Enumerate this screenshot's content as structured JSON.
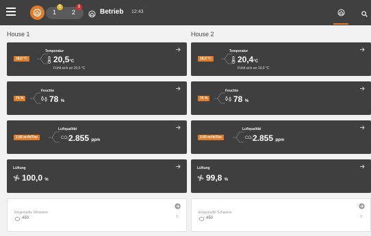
{
  "topbar": {
    "badge_1": "1",
    "badge_2": "2",
    "badge_1_count": "1",
    "badge_2_count": "1",
    "mode": "Betrieb",
    "time": "12:43"
  },
  "houses": [
    {
      "title": "House 1",
      "temperature": {
        "label": "Temperatur",
        "setpoint": "18,0 °C",
        "value": "20,5",
        "unit": "°C",
        "sub": "Fühlt sich an 20,5 °C"
      },
      "humidity": {
        "label": "Feuchte",
        "setpoint": "75 %",
        "value": "78",
        "unit": "%"
      },
      "air_quality": {
        "label": "Luftqualität",
        "setpoint": "2.50 m³/h/Tier",
        "gas": "CO₂",
        "value": "2.855",
        "unit": "ppm"
      },
      "ventilation": {
        "label": "Lüftung",
        "value": "100,0",
        "unit": "%"
      },
      "animals": {
        "label": "Eingestallte Schweine",
        "value": "450"
      }
    },
    {
      "title": "House 2",
      "temperature": {
        "label": "Temperatur",
        "setpoint": "18,0 °C",
        "value": "20,4",
        "unit": "°C",
        "sub": "Fühlt sich an 19,9 °C"
      },
      "humidity": {
        "label": "Feuchte",
        "setpoint": "75 %",
        "value": "78",
        "unit": "%"
      },
      "air_quality": {
        "label": "Luftqualität",
        "setpoint": "2.50 m³/h/Tier",
        "gas": "CO₂",
        "value": "2.855",
        "unit": "ppm"
      },
      "ventilation": {
        "label": "Lüftung",
        "value": "99,8",
        "unit": "%"
      },
      "animals": {
        "label": "Eingestallte Schweine",
        "value": "450"
      }
    }
  ],
  "colors": {
    "accent": "#e07b2a",
    "topbar": "#404040",
    "card": "#3f3f3f",
    "background": "#f2f2f2"
  }
}
